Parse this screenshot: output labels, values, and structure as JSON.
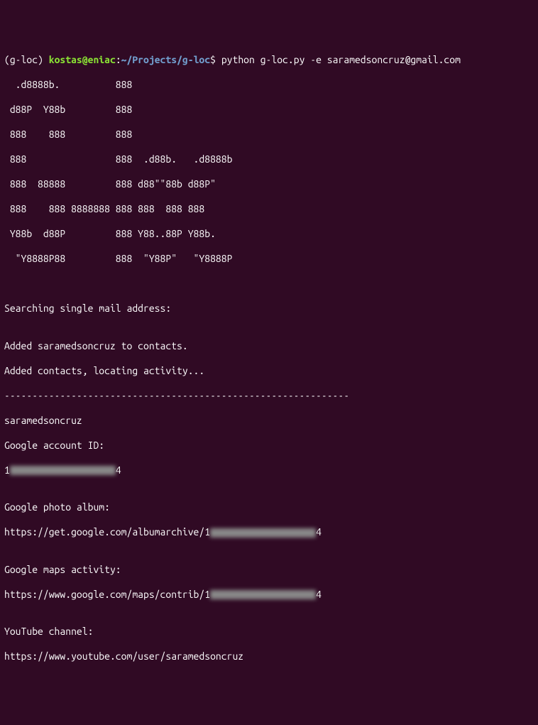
{
  "prompt": {
    "env": "(g-loc) ",
    "userhost": "kostas@eniac",
    "colon": ":",
    "path": "~/Projects/g-loc",
    "dollar": "$ ",
    "command": "python g-loc.py -e saramedsoncruz@gmail.com"
  },
  "ascii_art": {
    "l1": "  .d8888b.          888",
    "l2": " d88P  Y88b         888",
    "l3": " 888    888         888",
    "l4": " 888                888  .d88b.   .d8888b",
    "l5": " 888  88888         888 d88\"\"88b d88P\"",
    "l6": " 888    888 8888888 888 888  888 888",
    "l7": " Y88b  d88P         888 Y88..88P Y88b.",
    "l8": "  \"Y8888P88         888  \"Y88P\"   \"Y8888P"
  },
  "output": {
    "searching": "Searching single mail address:",
    "blank": "",
    "added_contact": "Added saramedsoncruz to contacts.",
    "locating": "Added contacts, locating activity...",
    "divider": "--------------------------------------------------------------",
    "username": "saramedsoncruz",
    "account_id_label": "Google account ID:",
    "account_id_prefix": "1",
    "account_id_redacted": "XXXXXXXXXXXXXXXXXXX",
    "account_id_suffix": "4",
    "photo_label": "Google photo album:",
    "photo_url_prefix": "https://get.google.com/albumarchive/1",
    "photo_url_redacted": "XXXXXXXXXXXXXXXXXXX",
    "photo_url_suffix": "4",
    "maps_label": "Google maps activity:",
    "maps_url_prefix": "https://www.google.com/maps/contrib/1",
    "maps_url_redacted": "XXXXXXXXXXXXXXXXXXX",
    "maps_url_suffix": "4",
    "youtube_label": "YouTube channel:",
    "youtube_url": "https://www.youtube.com/user/saramedsoncruz"
  }
}
